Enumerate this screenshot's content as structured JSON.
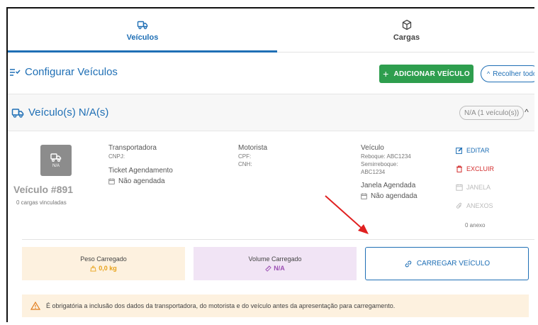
{
  "tabs": {
    "veiculos": {
      "label": "Veículos",
      "icon": "truck-icon"
    },
    "cargas": {
      "label": "Cargas",
      "icon": "box-icon"
    }
  },
  "config": {
    "title": "Configurar Veículos",
    "add_button": "ADICIONAR VEÍCULO",
    "collapse_button": "Recolher todos"
  },
  "panel": {
    "title": "Veículo(s) N/A(s)",
    "chip": "N/A (1 veículo(s))"
  },
  "vehicle": {
    "badge_text": "N/A",
    "name": "Veículo #891",
    "cargas": "0 cargas vinculadas"
  },
  "transportadora": {
    "label": "Transportadora",
    "cnpj_label": "CNPJ:",
    "ticket_label": "Ticket Agendamento",
    "ticket_value": "Não agendada"
  },
  "motorista": {
    "label": "Motorista",
    "cpf_label": "CPF:",
    "cnh_label": "CNH:"
  },
  "veiculo": {
    "label": "Veículo",
    "reboque": "Reboque: ABC1234",
    "semirreboque_label": "Semirreboque:",
    "semirreboque_value": "ABC1234",
    "janela_label": "Janela Agendada",
    "janela_value": "Não agendada"
  },
  "actions": {
    "edit": "EDITAR",
    "delete": "EXCLUIR",
    "janela": "JANELA",
    "anexos": "ANEXOS",
    "anexo_count": "0 anexo"
  },
  "metrics": {
    "peso_label": "Peso Carregado",
    "peso_value": "0,0 kg",
    "volume_label": "Volume Carregado",
    "volume_value": "N/A"
  },
  "load_button": "CARREGAR VEÍCULO",
  "alert": "É obrigatória a inclusão dos dados da transportadora, do motorista e do veículo antes da apresentação para carregamento.",
  "colors": {
    "primary": "#1f6fb5",
    "success": "#2e9e4e",
    "danger": "#d32f2f",
    "warning_bg": "#fdf1df",
    "volume_bg": "#f1e4f5",
    "annotation_arrow": "#e02020"
  }
}
